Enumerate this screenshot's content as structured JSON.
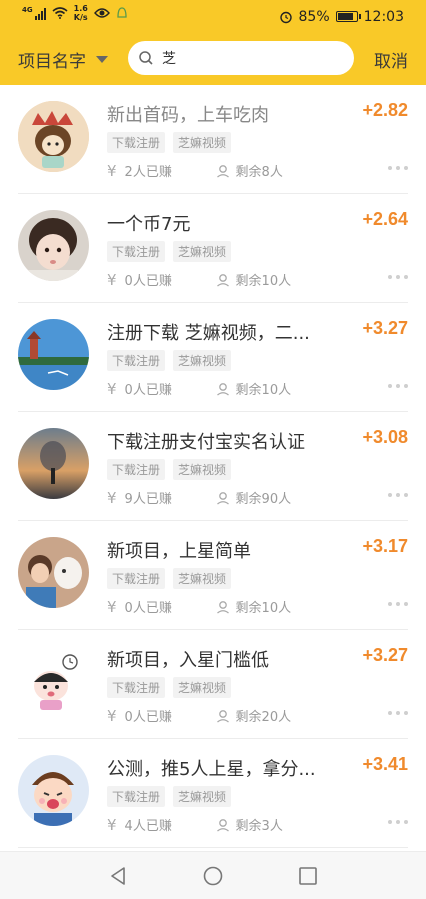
{
  "status_bar": {
    "signal": "4G",
    "net_speed": "1.6",
    "net_unit": "K/s",
    "battery": "85%",
    "time": "12:03"
  },
  "header": {
    "project_select": "项目名字",
    "search_value": "芝",
    "cancel_label": "取消"
  },
  "items": [
    {
      "title": "新出首码，上车吃肉",
      "price": "+2.82",
      "tags": [
        "下载注册",
        "芝嫲视频"
      ],
      "earned": "2人已赚",
      "remaining": "剩余8人"
    },
    {
      "title": "一个币7元",
      "price": "+2.64",
      "tags": [
        "下载注册",
        "芝嫲视频"
      ],
      "earned": "0人已赚",
      "remaining": "剩余10人"
    },
    {
      "title": "注册下载 芝嫲视频，二...",
      "price": "+3.27",
      "tags": [
        "下载注册",
        "芝嫲视频"
      ],
      "earned": "0人已赚",
      "remaining": "剩余10人"
    },
    {
      "title": "下载注册支付宝实名认证",
      "price": "+3.08",
      "tags": [
        "下载注册",
        "芝嫲视频"
      ],
      "earned": "9人已赚",
      "remaining": "剩余90人"
    },
    {
      "title": "新项目，上星简单",
      "price": "+3.17",
      "tags": [
        "下载注册",
        "芝嫲视频"
      ],
      "earned": "0人已赚",
      "remaining": "剩余10人"
    },
    {
      "title": "新项目，入星门槛低",
      "price": "+3.27",
      "tags": [
        "下载注册",
        "芝嫲视频"
      ],
      "earned": "0人已赚",
      "remaining": "剩余20人"
    },
    {
      "title": "公测，推5人上星，拿分...",
      "price": "+3.41",
      "tags": [
        "下载注册",
        "芝嫲视频"
      ],
      "earned": "4人已赚",
      "remaining": "剩余3人"
    }
  ],
  "colors": {
    "brand": "#f9c928",
    "price": "#f08a2c"
  },
  "icons": {
    "currency": "yen-icon",
    "person": "person-icon",
    "more": "more-dots-icon"
  }
}
